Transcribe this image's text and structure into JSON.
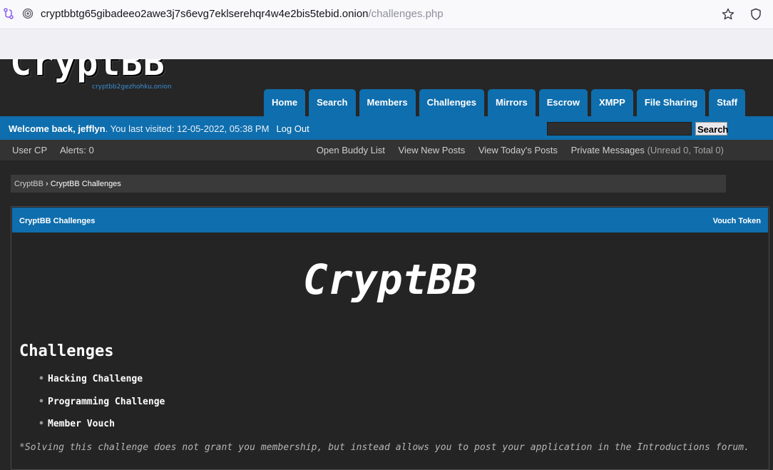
{
  "browser": {
    "url_host": "cryptbbtg65gibadeeo2awe3j7s6evg7eklserehqr4w4e2bis5tebid.onion",
    "url_path": "/challenges.php"
  },
  "logo": {
    "text": "CryptBB",
    "subtext": "cryptbb2gezhohku.onion"
  },
  "nav": {
    "items": [
      "Home",
      "Search",
      "Members",
      "Challenges",
      "Mirrors",
      "Escrow",
      "XMPP",
      "File Sharing",
      "Staff"
    ]
  },
  "welcome": {
    "prefix": "Welcome back, ",
    "username": "jefflyn",
    "last_visited": ". You last visited: 12-05-2022, 05:38 PM",
    "logout": "Log Out",
    "search_value": "",
    "search_button": "Search"
  },
  "subbar": {
    "user_cp": "User CP",
    "alerts": "Alerts: 0",
    "buddy_list": "Open Buddy List",
    "new_posts": "View New Posts",
    "todays_posts": "View Today's Posts",
    "private_messages": "Private Messages",
    "pm_counts": "(Unread 0, Total 0)"
  },
  "breadcrumb": {
    "root": "CryptBB",
    "separator": " › ",
    "current": "CryptBB Challenges"
  },
  "panel": {
    "title": "CryptBB Challenges",
    "vouch_token": "Vouch Token",
    "brand": "CryptBB",
    "heading": "Challenges",
    "challenges": [
      "Hacking Challenge",
      "Programming Challenge",
      "Member Vouch"
    ],
    "note": "*Solving this challenge does not grant you membership, but instead allows you to post your application in the Introductions forum."
  }
}
